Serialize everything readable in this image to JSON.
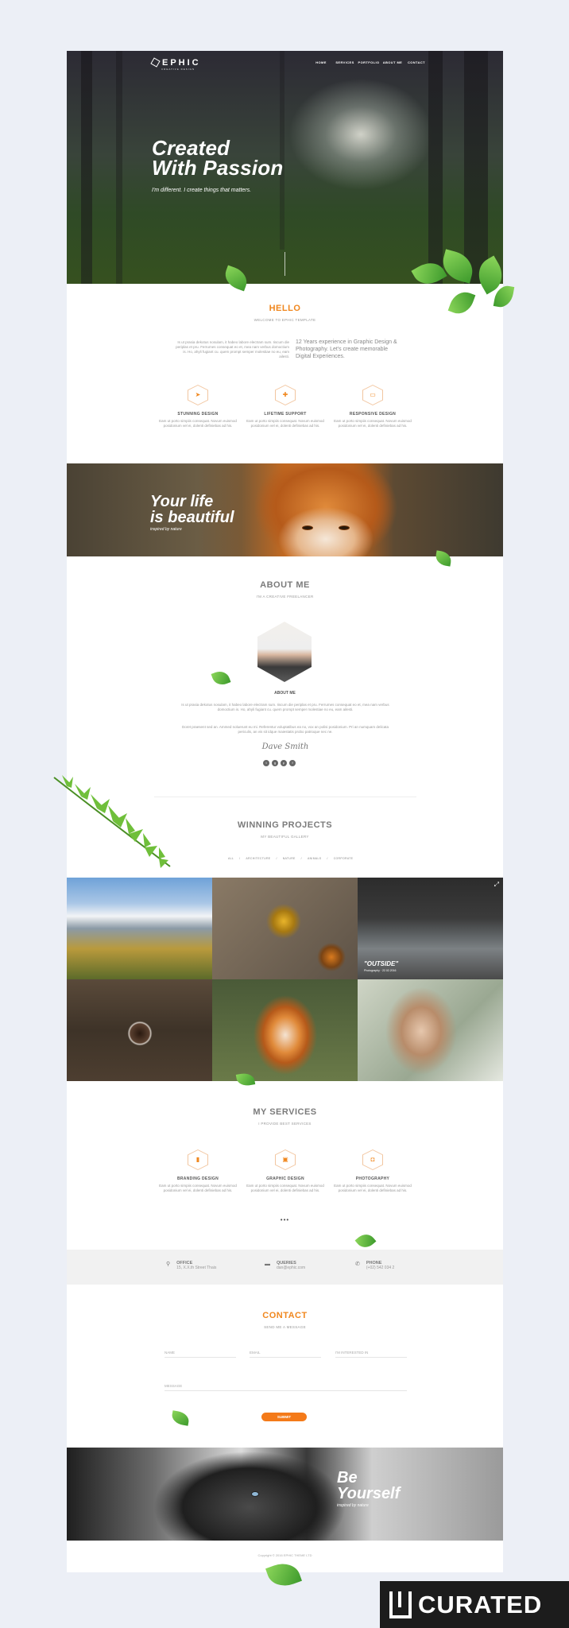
{
  "brand": {
    "name": "EPHIC",
    "tagline": "CREATIVE DESIGN"
  },
  "nav": [
    "HOME",
    "SERVICES",
    "PORTFOLIO",
    "ABOUT ME",
    "CONTACT"
  ],
  "hero": {
    "title_line1": "Created",
    "title_line2": "With Passion",
    "subtitle": "I'm different. I create things that matters."
  },
  "hello": {
    "title": "HELLO",
    "subtitle": "WELCOME TO EPHIC TEMPLATE",
    "text": "Is ut prasia dekotus nosulam, it habeo labore electram sum. Iiscum die periplas et pru. Ferrumes consequat eo et, mea nam verbus domoctium is. Ho, ahyli fugiant cu. quem prompt semper molestiae no eu, eam ailesti.",
    "quote": "12 Years experience in Graphic Design & Photography. Let's create memorable Digital Experiences."
  },
  "features": [
    {
      "icon": "paper-plane-icon",
      "glyph": "➤",
      "title": "STUNNING DESIGN",
      "text": "Eam ut porto simpiis consequat. Novum euismod posidonium vel ei, dolenti definiebas ad his."
    },
    {
      "icon": "lifebuoy-icon",
      "glyph": "✚",
      "title": "LIFETIME SUPPORT",
      "text": "Eam ut porto simpiis consequat. Novum euismod posidonium vel ei, dolenti definiebas ad his."
    },
    {
      "icon": "responsive-icon",
      "glyph": "▭",
      "title": "RESPONSIVE DESIGN",
      "text": "Eam ut porto simpiis consequat. Novum euismod posidonium vel ei, dolenti definiebas ad his."
    }
  ],
  "band": {
    "title_line1": "Your life",
    "title_line2": "is beautiful",
    "subtitle": "inspired by nature"
  },
  "about": {
    "title": "ABOUT ME",
    "subtitle": "I'M A CREATIVE FREELANCER",
    "name": "ABOUT ME",
    "text1": "Is ut prasia dekotus nosulam, it habeo labore electram sum. Iiscum die periplas et pru. Ferrumes consequat eo et, mea nam verbus domoctium is. Ho, ahyli fugiant cu. quem prompt semper molestiae no eu, eam ailesti.",
    "text2": "Doret praesent sed an. Ammed noluerunt eu mi. Referentur voluptatibus ea no, vox an polisi posidonium. Pri an numquam delicata periculis, an vis sit idque maiestatis probo patrioque nec ne.",
    "signature": "Dave Smith"
  },
  "social": [
    "t",
    "g",
    "p",
    "f"
  ],
  "projects": {
    "title": "WINNING PROJECTS",
    "subtitle": "MY BEAUTIFUL GALLERY",
    "filters": [
      "ALL",
      "ARCHITECTURE",
      "NATURE",
      "ANIMALS",
      "CORPORATE"
    ],
    "overlay_title": "\"OUTSIDE\"",
    "overlay_meta": "Photography · 22.02.2016"
  },
  "services": {
    "title": "MY SERVICES",
    "subtitle": "I PROVIDE BEST SERVICES",
    "more": "•••",
    "items": [
      {
        "icon": "bookmark-icon",
        "glyph": "▮",
        "title": "BRANDING DESIGN",
        "text": "Eam ut porto simpiis consequat. Novum euismod posidonium vel ei, dolenti definiebas ad his."
      },
      {
        "icon": "image-icon",
        "glyph": "▣",
        "title": "GRAPHIC DESIGN",
        "text": "Eam ut porto simpiis consequat. Novum euismod posidonium vel ei, dolenti definiebas ad his."
      },
      {
        "icon": "camera-icon",
        "glyph": "◘",
        "title": "PHOTOGRAPHY",
        "text": "Eam ut porto simpiis consequat. Novum euismod posidonium vel ei, dolenti definiebas ad his."
      }
    ]
  },
  "info": [
    {
      "icon": "map-pin-icon",
      "glyph": "⚲",
      "label": "OFFICE",
      "value": "15, X.X.th Street Thais"
    },
    {
      "icon": "briefcase-icon",
      "glyph": "▬",
      "label": "QUERIES",
      "value": "dan@ephic.com"
    },
    {
      "icon": "phone-icon",
      "glyph": "✆",
      "label": "PHONE",
      "value": "(+02) 542 034 2"
    }
  ],
  "contact": {
    "title": "CONTACT",
    "subtitle": "SEND ME A MESSAGE",
    "name_placeholder": "NAME",
    "email_placeholder": "EMAIL",
    "interest_placeholder": "I'M INTERESTED IN",
    "message_placeholder": "MESSAGE",
    "submit": "SUBMIT"
  },
  "footer_band": {
    "title_line1": "Be",
    "title_line2": "Yourself",
    "subtitle": "inspired by nature"
  },
  "footer": {
    "copyright": "Copyright © 2016 EPHIC THEME LTD"
  },
  "watermark": "CURATED",
  "colors": {
    "accent": "#f0871e",
    "page_bg": "#eceff6"
  }
}
